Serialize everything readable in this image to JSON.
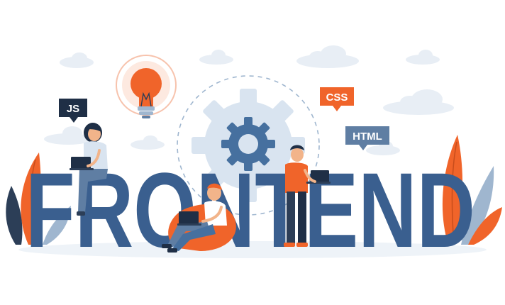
{
  "headline": {
    "text": "FRONTEND",
    "letters": [
      "F",
      "R",
      "O",
      "N",
      "T",
      "E",
      "N",
      "D"
    ]
  },
  "badges": {
    "js": "JS",
    "css": "CSS",
    "html": "HTML"
  },
  "colors": {
    "headline": "#3a5f8f",
    "headline_dark": "#2b4a73",
    "accent_orange": "#f0642a",
    "badge_dark": "#1f2f46",
    "badge_gray": "#5f7ea3",
    "gear": "#d9e4f0",
    "gear_inner": "#46709f",
    "cloud": "#e8eef5",
    "ground": "#eef3f8",
    "skin": "#f2b48a",
    "plant_dark": "#2c3e57"
  },
  "icons": {
    "lightbulb": "lightbulb-icon",
    "gear": "gear-icon",
    "laptop": "laptop-icon"
  }
}
